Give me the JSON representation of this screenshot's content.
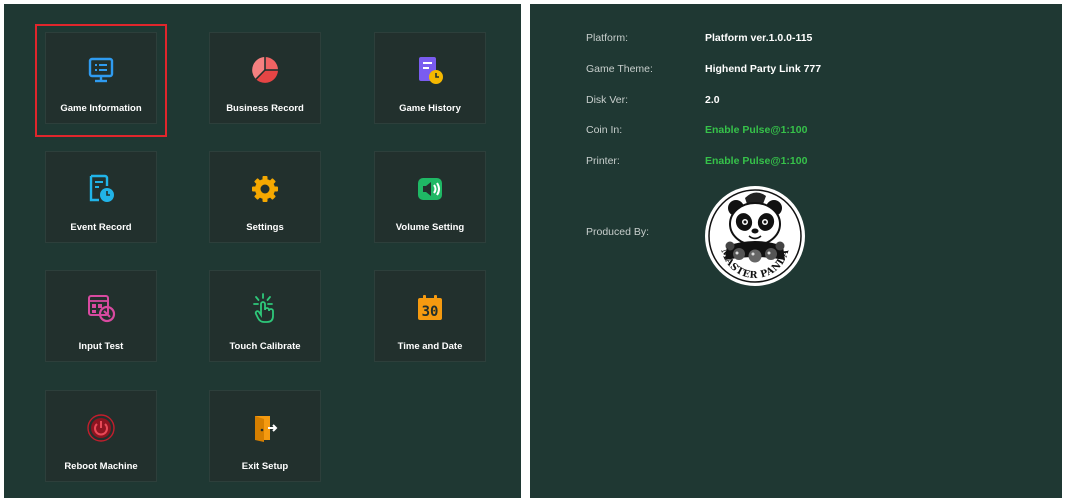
{
  "menu": {
    "items": [
      {
        "key": "game-information",
        "label": "Game Information",
        "icon": "monitor-list-icon",
        "selected": true
      },
      {
        "key": "business-record",
        "label": "Business Record",
        "icon": "pie-chart-icon"
      },
      {
        "key": "game-history",
        "label": "Game History",
        "icon": "document-clock-icon"
      },
      {
        "key": "event-record",
        "label": "Event Record",
        "icon": "record-clock-icon"
      },
      {
        "key": "settings",
        "label": "Settings",
        "icon": "gear-icon"
      },
      {
        "key": "volume-setting",
        "label": "Volume Setting",
        "icon": "speaker-icon"
      },
      {
        "key": "input-test",
        "label": "Input Test",
        "icon": "keypad-test-icon"
      },
      {
        "key": "touch-calibrate",
        "label": "Touch Calibrate",
        "icon": "touch-hand-icon"
      },
      {
        "key": "time-and-date",
        "label": "Time and Date",
        "icon": "calendar-icon",
        "icon_text": "30"
      },
      {
        "key": "reboot-machine",
        "label": "Reboot Machine",
        "icon": "power-icon"
      },
      {
        "key": "exit-setup",
        "label": "Exit Setup",
        "icon": "exit-door-icon"
      }
    ]
  },
  "info": {
    "platform_label": "Platform:",
    "platform_value": "Platform ver.1.0.0-115",
    "theme_label": "Game Theme:",
    "theme_value": "Highend Party Link 777",
    "disk_label": "Disk Ver:",
    "disk_value": "2.0",
    "coin_label": "Coin In:",
    "coin_value": "Enable Pulse@1:100",
    "printer_label": "Printer:",
    "printer_value": "Enable Pulse@1:100",
    "produced_label": "Produced By:",
    "producer_logo_text": "MASTER PANDA"
  },
  "colors": {
    "background": "#1f3833",
    "tile": "#22302d",
    "selected_border": "#e0262c",
    "enabled_green": "#36c24a"
  }
}
